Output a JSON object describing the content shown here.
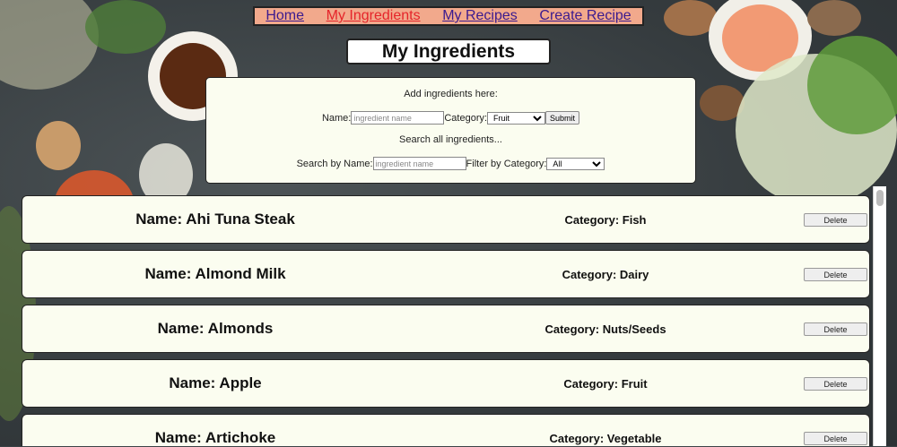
{
  "nav": {
    "items": [
      {
        "label": "Home",
        "active": false
      },
      {
        "label": "My Ingredients",
        "active": true
      },
      {
        "label": "My Recipes",
        "active": false
      },
      {
        "label": "Create Recipe",
        "active": false
      }
    ],
    "background_color": "#f2a98c",
    "link_color": "#3b1b8f",
    "active_color": "#e5252a"
  },
  "page_title": "My Ingredients",
  "add_form": {
    "heading": "Add ingredients here:",
    "name_label": "Name:",
    "name_placeholder": "ingredient name",
    "category_label": "Category:",
    "category_selected": "Fruit",
    "submit_label": "Submit"
  },
  "search_form": {
    "heading": "Search all ingredients...",
    "search_label": "Search by Name:",
    "search_placeholder": "ingredient name",
    "filter_label": "Filter by Category:",
    "filter_selected": "All"
  },
  "ingredients": [
    {
      "name": "Name: Ahi Tuna Steak",
      "category": "Category: Fish",
      "delete_label": "Delete"
    },
    {
      "name": "Name: Almond Milk",
      "category": "Category: Dairy",
      "delete_label": "Delete"
    },
    {
      "name": "Name: Almonds",
      "category": "Category: Nuts/Seeds",
      "delete_label": "Delete"
    },
    {
      "name": "Name: Apple",
      "category": "Category: Fruit",
      "delete_label": "Delete"
    },
    {
      "name": "Name: Artichoke",
      "category": "Category: Vegetable",
      "delete_label": "Delete"
    }
  ],
  "card_background": "#fbfdf0"
}
